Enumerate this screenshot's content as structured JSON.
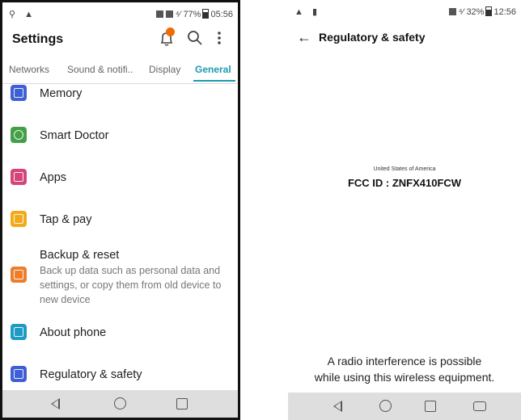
{
  "left_screen": {
    "status": {
      "left_icons": "⚲ ▲",
      "right_text": "77%",
      "time": "05:56"
    },
    "title": "Settings",
    "tabs": [
      {
        "label": "Networks"
      },
      {
        "label": "Sound & notifi.."
      },
      {
        "label": "Display"
      },
      {
        "label": "General"
      }
    ],
    "items": [
      {
        "label": "Memory",
        "icon": "memory-chip-icon",
        "color": "#3f5fd6"
      },
      {
        "label": "Smart Doctor",
        "icon": "smart-doctor-icon",
        "color": "#43a047"
      },
      {
        "label": "Apps",
        "icon": "apps-grid-icon",
        "color": "#d6457a"
      },
      {
        "label": "Tap & pay",
        "icon": "tap-pay-icon",
        "color": "#f2a91b"
      },
      {
        "label": "Backup & reset",
        "icon": "backup-icon",
        "color": "#ef7e2b",
        "description": "Back up data such as personal data and settings, or copy them from old device to new device"
      },
      {
        "label": "About phone",
        "icon": "info-icon",
        "color": "#1c9bc4"
      },
      {
        "label": "Regulatory & safety",
        "icon": "regulatory-icon",
        "color": "#3f5fd6"
      }
    ],
    "accent": "#1a9ab0"
  },
  "right_screen": {
    "status": {
      "left_icons": "▲ ▮",
      "right_text": "32%",
      "time": "12:56"
    },
    "title": "Regulatory & safety",
    "fcc_country": "United States of America",
    "fcc_id": "FCC ID : ZNFX410FCW",
    "warning_line1": "A radio interference is possible",
    "warning_line2": "while using this wireless equipment."
  }
}
